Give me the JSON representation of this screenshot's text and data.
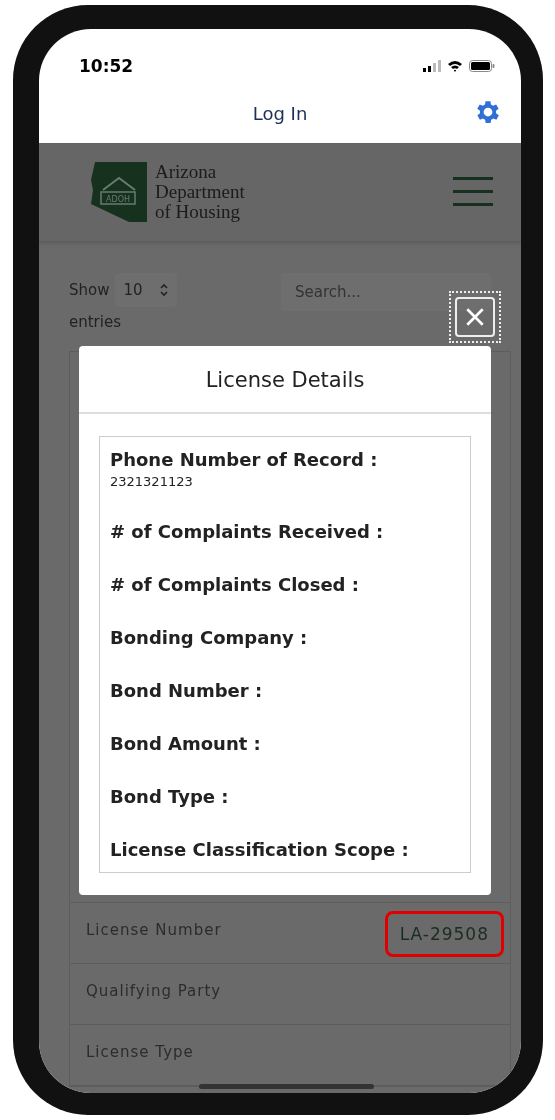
{
  "status_bar": {
    "time": "10:52"
  },
  "nav_bar": {
    "title": "Log In"
  },
  "header": {
    "logo_badge": "ADOH",
    "logo_lines": [
      "Arizona",
      "Department",
      "of Housing"
    ]
  },
  "table_controls": {
    "show_label": "Show",
    "page_size": "10",
    "entries_label": "entries",
    "search": {
      "placeholder": "Search..."
    }
  },
  "modal": {
    "title": "License Details",
    "close_focused": true,
    "fields": [
      {
        "label": "Phone Number of Record :",
        "value": "2321321123"
      },
      {
        "label": "# of Complaints Received :"
      },
      {
        "label": "# of Complaints Closed :"
      },
      {
        "label": "Bonding Company :"
      },
      {
        "label": "Bond Number :"
      },
      {
        "label": "Bond Amount :"
      },
      {
        "label": "Bond Type :"
      },
      {
        "label": "License Classification Scope :"
      }
    ]
  },
  "rows": [
    {
      "label": "License Number",
      "value": "LA-29508",
      "highlighted": true
    },
    {
      "label": "Qualifying Party",
      "highlighted": false
    },
    {
      "label": "License Type",
      "highlighted": false
    }
  ]
}
